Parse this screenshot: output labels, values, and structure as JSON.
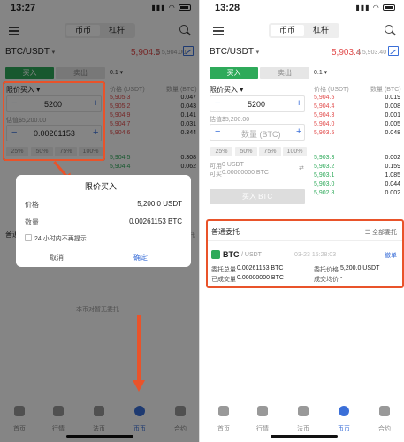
{
  "left": {
    "status_time": "13:27",
    "tabs": {
      "spot": "币币",
      "margin": "杠杆"
    },
    "pair": "BTC/USDT",
    "price": "5,904.5",
    "price_sub": "$ 5,904.00",
    "trade_tabs": {
      "buy": "买入",
      "sell": "卖出"
    },
    "depth": "0.1",
    "order_type": "限价买入",
    "col_price": "价格 (USDT)",
    "col_qty": "数量 (BTC)",
    "price_value": "5200",
    "price_hint": "估值$5,200.00",
    "amount_value": "0.00261153",
    "percents": [
      "25%",
      "50%",
      "75%",
      "100%"
    ],
    "asks": [
      {
        "price": "5,905.3",
        "qty": "0.047"
      },
      {
        "price": "5,905.2",
        "qty": "0.043"
      },
      {
        "price": "5,904.9",
        "qty": "0.141"
      },
      {
        "price": "5,904.7",
        "qty": "0.031"
      },
      {
        "price": "5,904.6",
        "qty": "0.344"
      }
    ],
    "bids": [
      {
        "price": "5,904.5",
        "qty": "0.308"
      },
      {
        "price": "5,904.4",
        "qty": "0.062"
      }
    ],
    "dialog": {
      "title": "限价买入",
      "price_label": "价格",
      "price_value": "5,200.0 USDT",
      "qty_label": "数量",
      "qty_value": "0.00261153 BTC",
      "checkbox_label": "24 小时内不再提示",
      "cancel": "取消",
      "confirm": "确定"
    },
    "section_title": "普通委",
    "all_orders_fragment": "部委托",
    "empty_text": "本币对暂无委托",
    "nav": [
      "首页",
      "行情",
      "法币",
      "币币",
      "合约"
    ]
  },
  "right": {
    "status_time": "13:28",
    "tabs": {
      "spot": "币币",
      "margin": "杠杆"
    },
    "pair": "BTC/USDT",
    "price": "5,903.4",
    "price_sub": "$ 5,903.40",
    "trade_tabs": {
      "buy": "买入",
      "sell": "卖出"
    },
    "depth": "0.1",
    "order_type": "限价买入",
    "col_price": "价格 (USDT)",
    "col_qty": "数量 (BTC)",
    "price_value": "5200",
    "price_hint": "估值$5,200.00",
    "amount_placeholder": "数量 (BTC)",
    "percents": [
      "25%",
      "50%",
      "75%",
      "100%"
    ],
    "available_label": "可用",
    "available_value": "0 USDT",
    "buyable_label": "可买",
    "buyable_value": "0.00000000 BTC",
    "buy_button": "买入 BTC",
    "asks": [
      {
        "price": "5,904.5",
        "qty": "0.019"
      },
      {
        "price": "5,904.4",
        "qty": "0.008"
      },
      {
        "price": "5,904.3",
        "qty": "0.001"
      },
      {
        "price": "5,904.0",
        "qty": "0.005"
      },
      {
        "price": "5,903.5",
        "qty": "0.048"
      }
    ],
    "bids": [
      {
        "price": "5,903.3",
        "qty": "0.002"
      },
      {
        "price": "5,903.2",
        "qty": "0.159"
      },
      {
        "price": "5,903.1",
        "qty": "1.085"
      },
      {
        "price": "5,903.0",
        "qty": "0.044"
      },
      {
        "price": "5,902.8",
        "qty": "0.002"
      }
    ],
    "section_title": "普通委托",
    "all_orders": "全部委托",
    "order": {
      "symbol": "BTC",
      "quote": "/ USDT",
      "time": "03-23 15:28:03",
      "cancel": "撤单",
      "total_label": "委托总量",
      "total_value": "0.00261153 BTC",
      "filled_label": "已成交量",
      "filled_value": "0.00000000 BTC",
      "order_price_label": "委托价格",
      "order_price_value": "5,200.0 USDT",
      "avg_label": "成交均价",
      "avg_value": "-"
    },
    "nav": [
      "首页",
      "行情",
      "法币",
      "币币",
      "合约"
    ]
  },
  "colors": {
    "accent": "#3b6fd8",
    "buy": "#2eaa5a",
    "sell": "#e24c4c",
    "highlight": "#e9532a"
  }
}
